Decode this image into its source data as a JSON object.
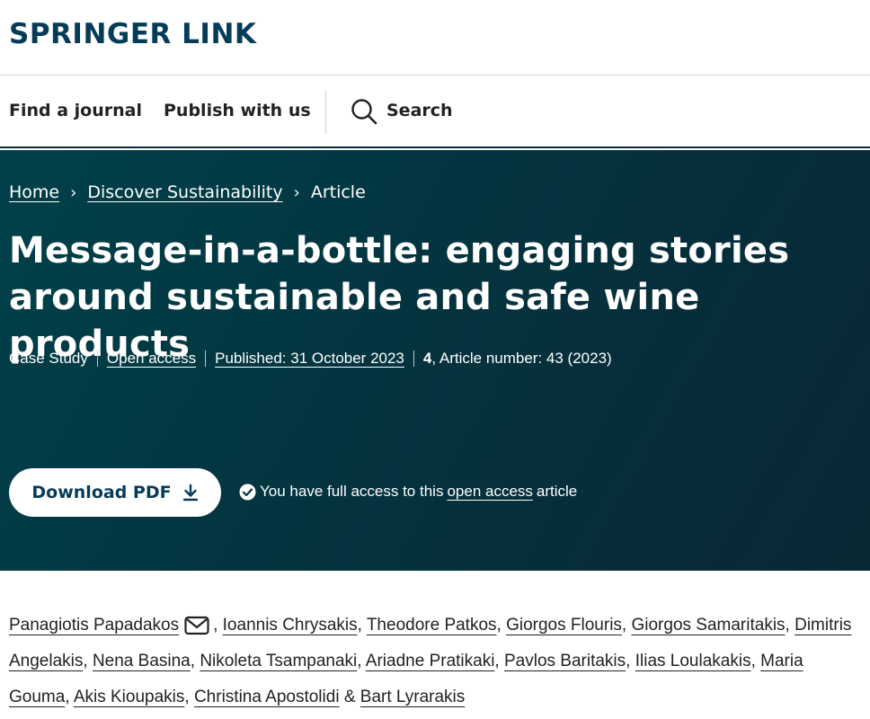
{
  "header": {
    "logo": "SPRINGER LINK"
  },
  "nav": {
    "find_journal": "Find a journal",
    "publish": "Publish with us",
    "search": "Search"
  },
  "breadcrumb": {
    "home": "Home",
    "journal": "Discover Sustainability",
    "current": "Article"
  },
  "article": {
    "title": "Message-in-a-bottle: engaging stories around sustainable and safe wine products",
    "type": "Case Study",
    "open_access": "Open access",
    "published": "Published: 31 October 2023",
    "volume": "4",
    "article_number": ", Article number: 43 (2023)"
  },
  "actions": {
    "download": "Download PDF",
    "access_prefix": "You have full access to this",
    "access_link": "open access",
    "access_suffix": "article"
  },
  "authors": [
    "Panagiotis Papadakos",
    "Ioannis Chrysakis",
    "Theodore Patkos",
    "Giorgos Flouris",
    "Giorgos Samaritakis",
    "Dimitris Angelakis",
    "Nena Basina",
    "Nikoleta Tsampanaki",
    "Ariadne Pratikaki",
    "Pavlos Baritakis",
    "Ilias Loulakakis",
    "Maria Gouma",
    "Akis Kioupakis",
    "Christina Apostolidi",
    "Bart Lyrarakis"
  ],
  "colors": {
    "brand": "#063c57",
    "hero_bg": "#01414a"
  },
  "icons": {
    "search": "search-icon",
    "download": "download-icon",
    "check": "check-circle-icon",
    "mail": "mail-icon"
  }
}
